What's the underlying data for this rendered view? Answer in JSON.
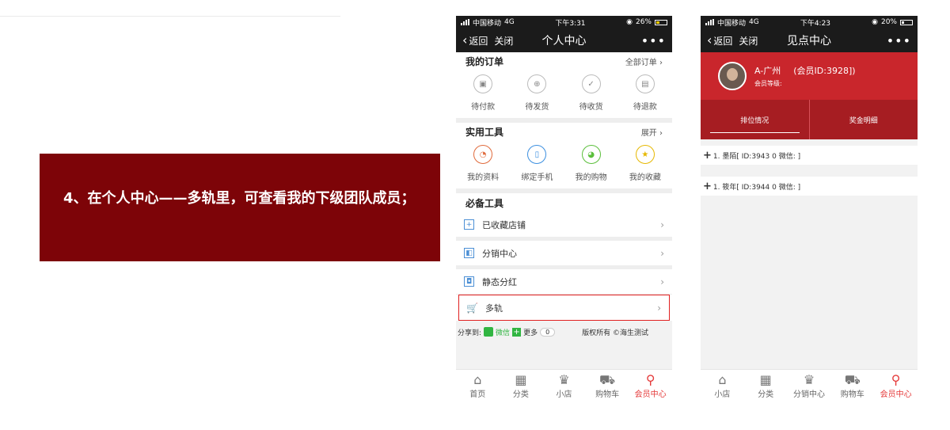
{
  "callout": {
    "text": "4、在个人中心——多轨里，可查看我的下级团队成员；"
  },
  "phone1": {
    "status": {
      "carrier": "中国移动",
      "net": "4G",
      "time": "下午3:31",
      "battery": "26%"
    },
    "nav": {
      "back": "返回",
      "close": "关闭",
      "title": "个人中心",
      "more": "•••"
    },
    "orders": {
      "title": "我的订单",
      "all": "全部订单 ›",
      "items": [
        "待付款",
        "待发货",
        "待收货",
        "待退款"
      ]
    },
    "tools": {
      "title": "实用工具",
      "expand": "展开 ›",
      "items": [
        "我的资料",
        "绑定手机",
        "我的购物",
        "我的收藏"
      ]
    },
    "essential": {
      "title": "必备工具",
      "items": [
        "已收藏店铺",
        "分销中心",
        "静态分红",
        "多轨"
      ]
    },
    "share": {
      "label": "分享到:",
      "wechat": "微信",
      "more": "更多",
      "count": "0",
      "copyright": "版权所有 ©海生测试"
    },
    "tabbar": [
      "首页",
      "分类",
      "小店",
      "购物车",
      "会员中心"
    ]
  },
  "phone2": {
    "status": {
      "carrier": "中国移动",
      "net": "4G",
      "time": "下午4:23",
      "battery": "20%"
    },
    "nav": {
      "back": "返回",
      "close": "关闭",
      "title": "见点中心",
      "more": "•••"
    },
    "member": {
      "name": "A-广州",
      "id": "(会员ID:3928])",
      "level": "会员等级:"
    },
    "tabs": [
      "排位情况",
      "奖金明细"
    ],
    "team": [
      "1. 墨陌[ ID:3943 0 微信: ]",
      "1. 筱年[ ID:3944 0 微信: ]"
    ],
    "tabbar": [
      "小店",
      "分类",
      "分销中心",
      "购物车",
      "会员中心"
    ]
  },
  "colors": {
    "callout_bg": "#7d0408",
    "accent_red": "#c9262c",
    "active_tab": "#e53b3b"
  }
}
